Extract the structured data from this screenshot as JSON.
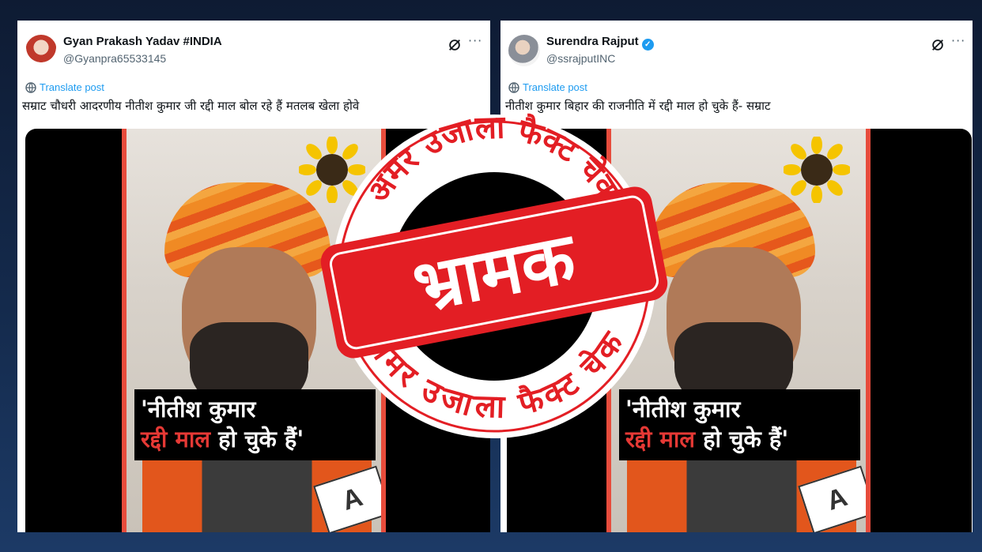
{
  "posts": [
    {
      "author_name": "Gyan Prakash Yadav #INDIA",
      "handle": "@Gyanpra65533145",
      "verified": false,
      "translate_label": "Translate post",
      "text": "सम्राट चौधरी आदरणीय नीतीश कुमार जी रद्दी माल बोल रहे हैं मतलब खेला होवे",
      "more_label": "···",
      "video_caption_line1": "'नीतीश कुमार",
      "video_caption_red": "रद्दी माल",
      "video_caption_rest": " हो चुके हैं'",
      "watermark": "A"
    },
    {
      "author_name": "Surendra Rajput",
      "handle": "@ssrajputINC",
      "verified": true,
      "translate_label": "Translate post",
      "text": "नीतीश कुमार बिहार की राजनीति में रद्दी माल हो चुके हैं- सम्राट",
      "more_label": "···",
      "video_caption_line1": "'नीतीश कुमार",
      "video_caption_red": "रद्दी माल",
      "video_caption_rest": " हो चुके हैं'",
      "watermark": "A"
    }
  ],
  "stamp": {
    "top_arc_text": "अमर उजाला फैक्ट चेक",
    "bottom_arc_text": "अमर उजाला फैक्ट चेक",
    "verdict": "भ्रामक",
    "color": "#e31e24"
  },
  "colors": {
    "link": "#1d9bf0",
    "name": "#0f1419",
    "secondary": "#536471",
    "background": "#142a4c"
  }
}
